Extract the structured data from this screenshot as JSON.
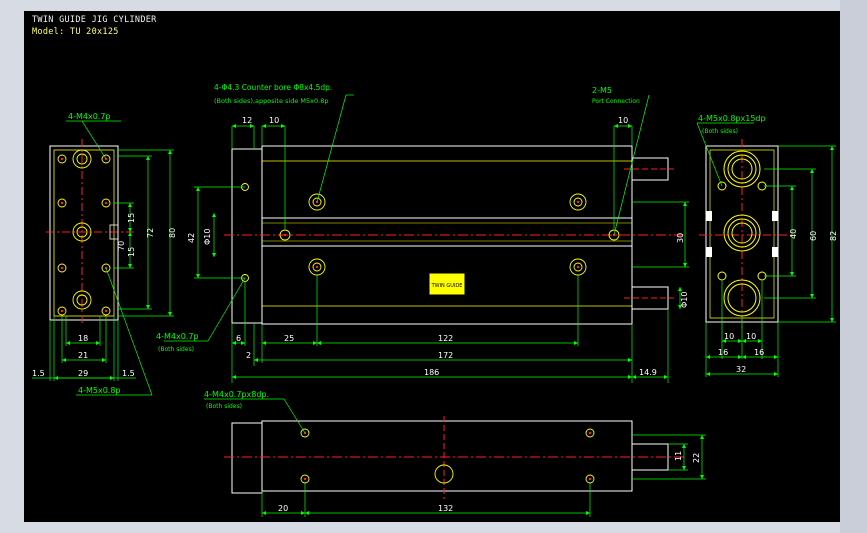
{
  "header": {
    "title": "TWIN GUIDE JIG CYLINDER",
    "model": "Model: TU 20x125"
  },
  "colors": {
    "background": "#000000",
    "outline": "#ffffff",
    "dimension": "#00ff00",
    "centerline": "#ff2020",
    "hole": "#ffff00",
    "text": "#ffffff"
  },
  "callouts": {
    "counter_bore_1": "4-Φ4.3 Counter bore Φ8x4.5dp.",
    "counter_bore_2": "(Both sides),apposite side M5x0.8p",
    "m5_port": "2-M5",
    "port_connection": "Port Connection",
    "m4_top_left": "4-M4x0.7p",
    "m5_right": "4-M5x0.8px15dp",
    "both_sides_right": "(Both sides)",
    "m4_mid": "4-M4x0.7p",
    "both_sides_mid": "(Both sides)",
    "m5_left_bottom": "4-M5x0.8p",
    "m4_bottom": "4-M4x0.7px8dp.",
    "both_sides_bottom": "(Both sides)",
    "label_plate": "TWIN GUIDE"
  },
  "dims": {
    "d12": "12",
    "d10a": "10",
    "d10b": "10",
    "d42": "42",
    "phi10a": "Φ10",
    "d30": "30",
    "phi10b": "Φ10",
    "d6": "6",
    "d25": "25",
    "d122": "122",
    "d2": "2",
    "d172": "172",
    "d186": "186",
    "d14_9": "14.9",
    "l15a": "15",
    "l15b": "15",
    "l70": "70",
    "l72": "72",
    "l80": "80",
    "l18": "18",
    "l21": "21",
    "l29": "29",
    "l1_5a": "1.5",
    "l1_5b": "1.5",
    "r40": "40",
    "r60": "60",
    "r82": "82",
    "r10a": "10",
    "r10b": "10",
    "r16a": "16",
    "r16b": "16",
    "r32": "32",
    "b11": "11",
    "b22": "22",
    "b20": "20",
    "b132": "132"
  }
}
